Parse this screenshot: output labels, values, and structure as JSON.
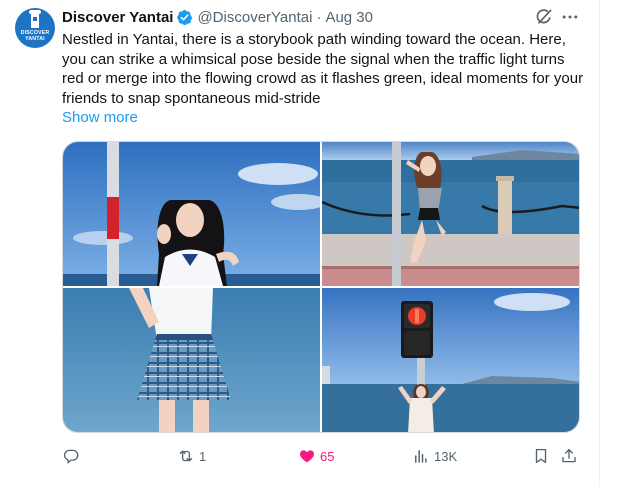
{
  "author": {
    "display_name": "Discover Yantai",
    "handle": "@DiscoverYantai",
    "separator": "·",
    "date": "Aug 30",
    "verified": true,
    "avatar_text_line1": "DISCOVER",
    "avatar_text_line2": "YANTAI"
  },
  "tweet": {
    "text": "Nestled in Yantai, there is a storybook path winding toward the ocean. Here, you can strike a whimsical pose beside the signal when the traffic light turns red or merge into the flowing crowd as it flashes green, ideal moments for your friends to snap spontaneous mid-stride",
    "show_more": "Show more"
  },
  "media": {
    "photo_count": 4
  },
  "actions": {
    "reply_count": "",
    "retweet_count": "1",
    "like_count": "65",
    "liked": true,
    "view_count": "13K"
  },
  "icons": {
    "verified": "verified-badge-icon",
    "grok": "grok-icon",
    "more": "more-icon",
    "reply": "reply-icon",
    "retweet": "retweet-icon",
    "like": "heart-icon",
    "views": "views-icon",
    "bookmark": "bookmark-icon",
    "share": "share-icon"
  },
  "colors": {
    "accent": "#1d9bf0",
    "like": "#f91880",
    "secondary_text": "#536471",
    "avatar_bg": "#1d74c4"
  }
}
